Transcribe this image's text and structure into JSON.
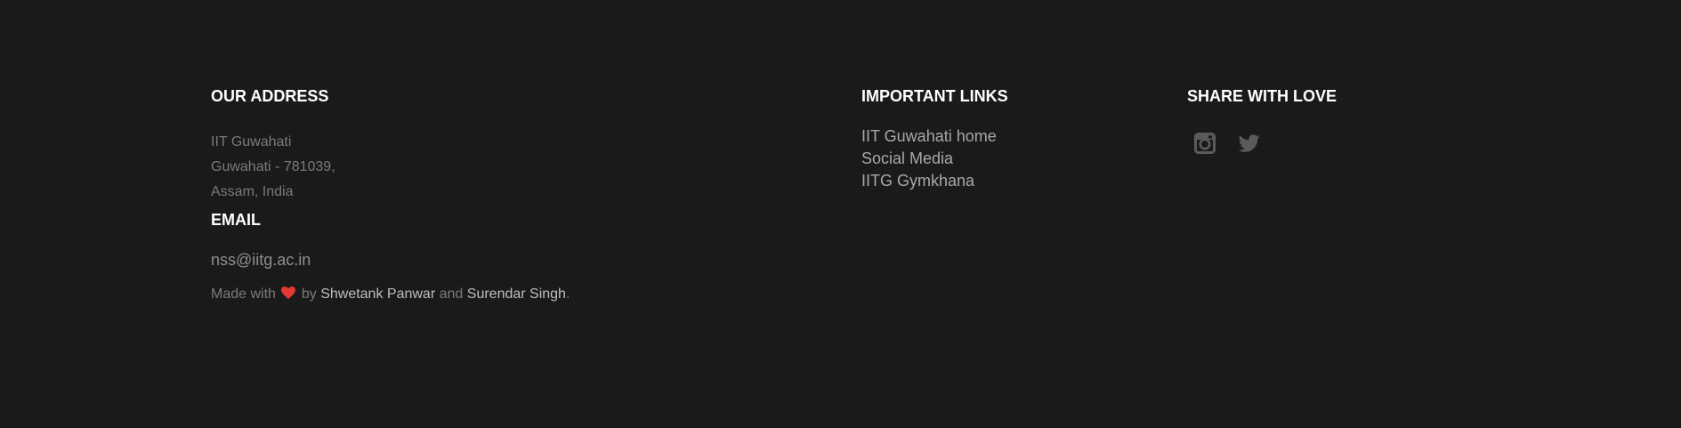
{
  "address": {
    "heading": "OUR ADDRESS",
    "lines": [
      "IIT Guwahati",
      "Guwahati - 781039,",
      "Assam, India"
    ]
  },
  "email": {
    "heading": "EMAIL",
    "value": "nss@iitg.ac.in"
  },
  "credits": {
    "prefix": "Made with",
    "by": "by",
    "author1": "Shwetank Panwar",
    "and": "and",
    "author2": "Surendar Singh",
    "suffix": ".",
    "heart_color": "#e53935"
  },
  "links": {
    "heading": "IMPORTANT LINKS",
    "items": [
      "IIT Guwahati home",
      "Social Media",
      "IITG Gymkhana"
    ]
  },
  "share": {
    "heading": "SHARE WITH LOVE",
    "icons": [
      "instagram-icon",
      "twitter-icon"
    ]
  },
  "colors": {
    "background": "#1a1a1a",
    "heading": "#ffffff",
    "muted_text": "#7a7a7a",
    "link": "#a8a8a8",
    "icon": "#5a5a5a"
  }
}
